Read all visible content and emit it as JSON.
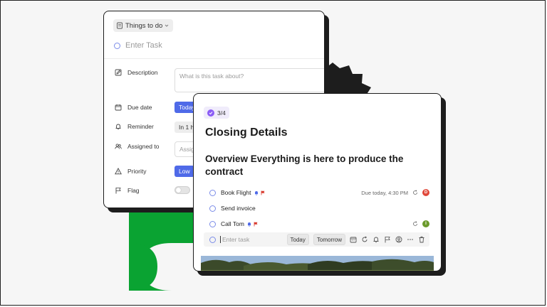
{
  "back_card": {
    "list_name": "Things to do",
    "task_placeholder": "Enter Task",
    "fields": {
      "description_label": "Description",
      "description_placeholder": "What is this task about?",
      "due_date_label": "Due date",
      "due_date_value": "Today",
      "reminder_label": "Reminder",
      "reminder_value": "In 1 ho",
      "assigned_label": "Assigned to",
      "assigned_placeholder": "Assig",
      "priority_label": "Priority",
      "priority_value": "Low",
      "flag_label": "Flag"
    }
  },
  "front_card": {
    "progress": "3/4",
    "title": "Closing Details",
    "subtitle": "Overview Everything is here to produce the contract",
    "tasks": [
      {
        "name": "Book Flight",
        "due": "Due today, 4:30 PM",
        "avatar": "D",
        "avatar_color": "#e0483a"
      },
      {
        "name": "Send invoice"
      },
      {
        "name": "Call Tom",
        "avatar": "I",
        "avatar_color": "#6b9a2b"
      }
    ],
    "new_task": {
      "placeholder": "Enter task",
      "today_label": "Today",
      "tomorrow_label": "Tomorrow"
    }
  },
  "colors": {
    "accent_blue": "#4f6ae8",
    "shape_green": "#0aa332",
    "progress_purple": "#8b5cf6"
  }
}
